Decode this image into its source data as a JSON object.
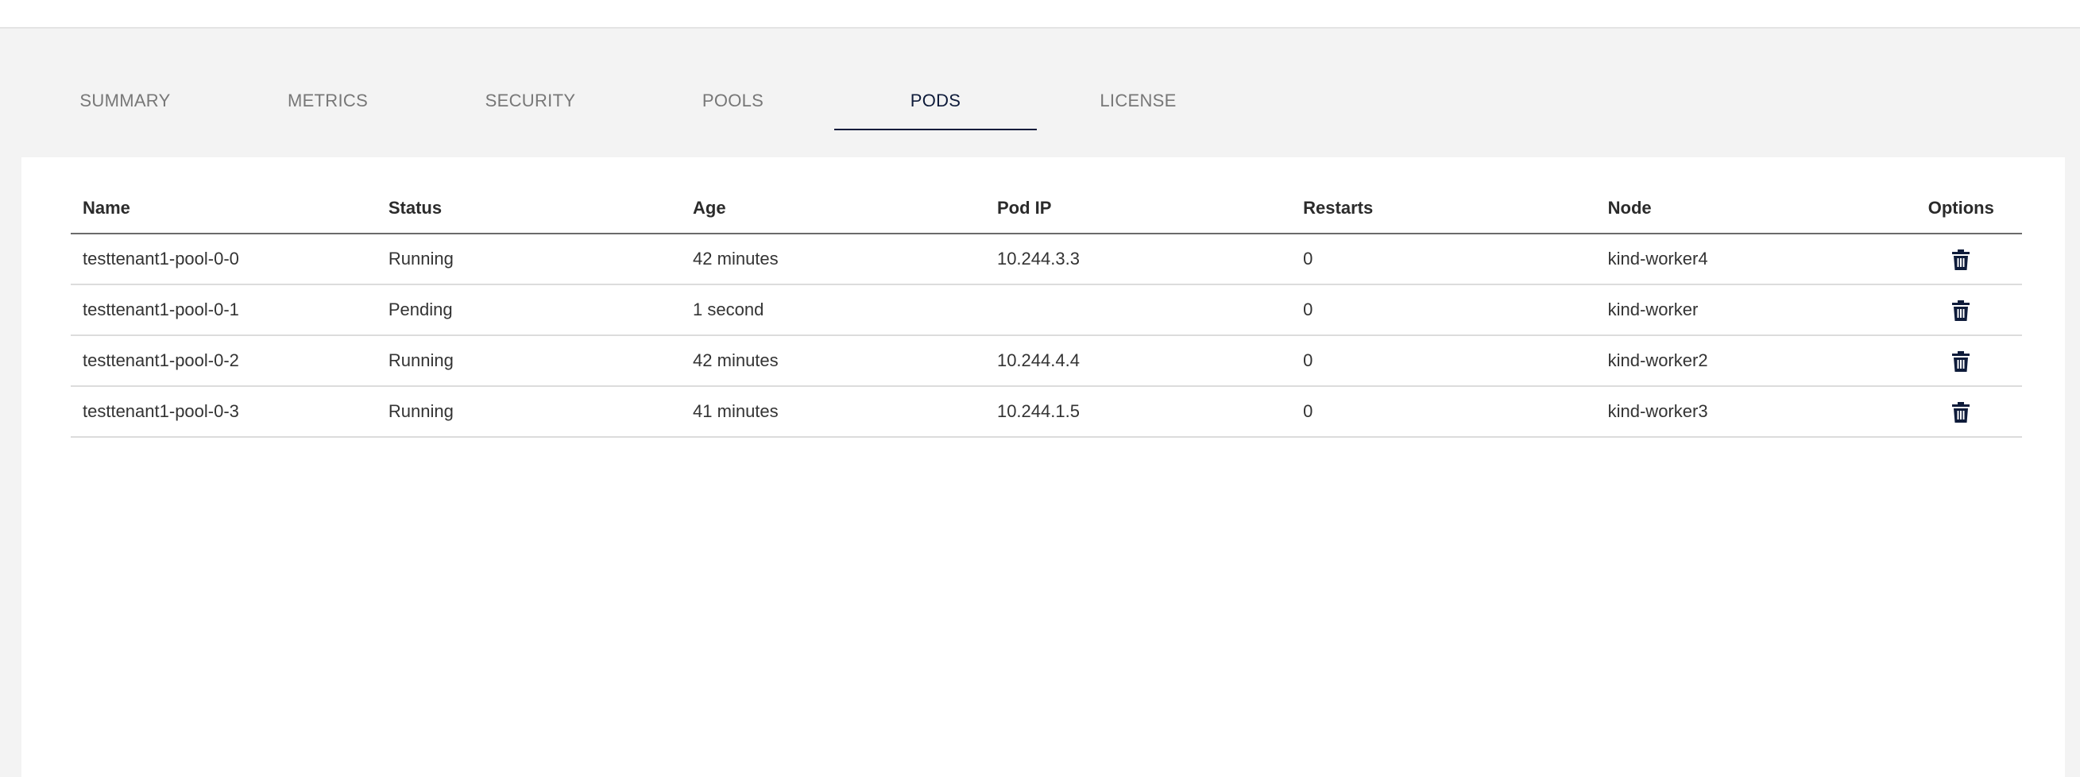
{
  "tabs": [
    {
      "label": "SUMMARY",
      "active": false
    },
    {
      "label": "METRICS",
      "active": false
    },
    {
      "label": "SECURITY",
      "active": false
    },
    {
      "label": "POOLS",
      "active": false
    },
    {
      "label": "PODS",
      "active": true
    },
    {
      "label": "LICENSE",
      "active": false
    }
  ],
  "table": {
    "headers": {
      "name": "Name",
      "status": "Status",
      "age": "Age",
      "pod_ip": "Pod IP",
      "restarts": "Restarts",
      "node": "Node",
      "options": "Options"
    },
    "rows": [
      {
        "name": "testtenant1-pool-0-0",
        "status": "Running",
        "age": "42 minutes",
        "pod_ip": "10.244.3.3",
        "restarts": "0",
        "node": "kind-worker4"
      },
      {
        "name": "testtenant1-pool-0-1",
        "status": "Pending",
        "age": "1 second",
        "pod_ip": "",
        "restarts": "0",
        "node": "kind-worker"
      },
      {
        "name": "testtenant1-pool-0-2",
        "status": "Running",
        "age": "42 minutes",
        "pod_ip": "10.244.4.4",
        "restarts": "0",
        "node": "kind-worker2"
      },
      {
        "name": "testtenant1-pool-0-3",
        "status": "Running",
        "age": "41 minutes",
        "pod_ip": "10.244.1.5",
        "restarts": "0",
        "node": "kind-worker3"
      }
    ],
    "row_action_icon": "trash-icon"
  },
  "colors": {
    "accent": "#0e1b3a",
    "background": "#f3f3f3",
    "panel": "#ffffff",
    "tab_inactive": "#777777"
  }
}
